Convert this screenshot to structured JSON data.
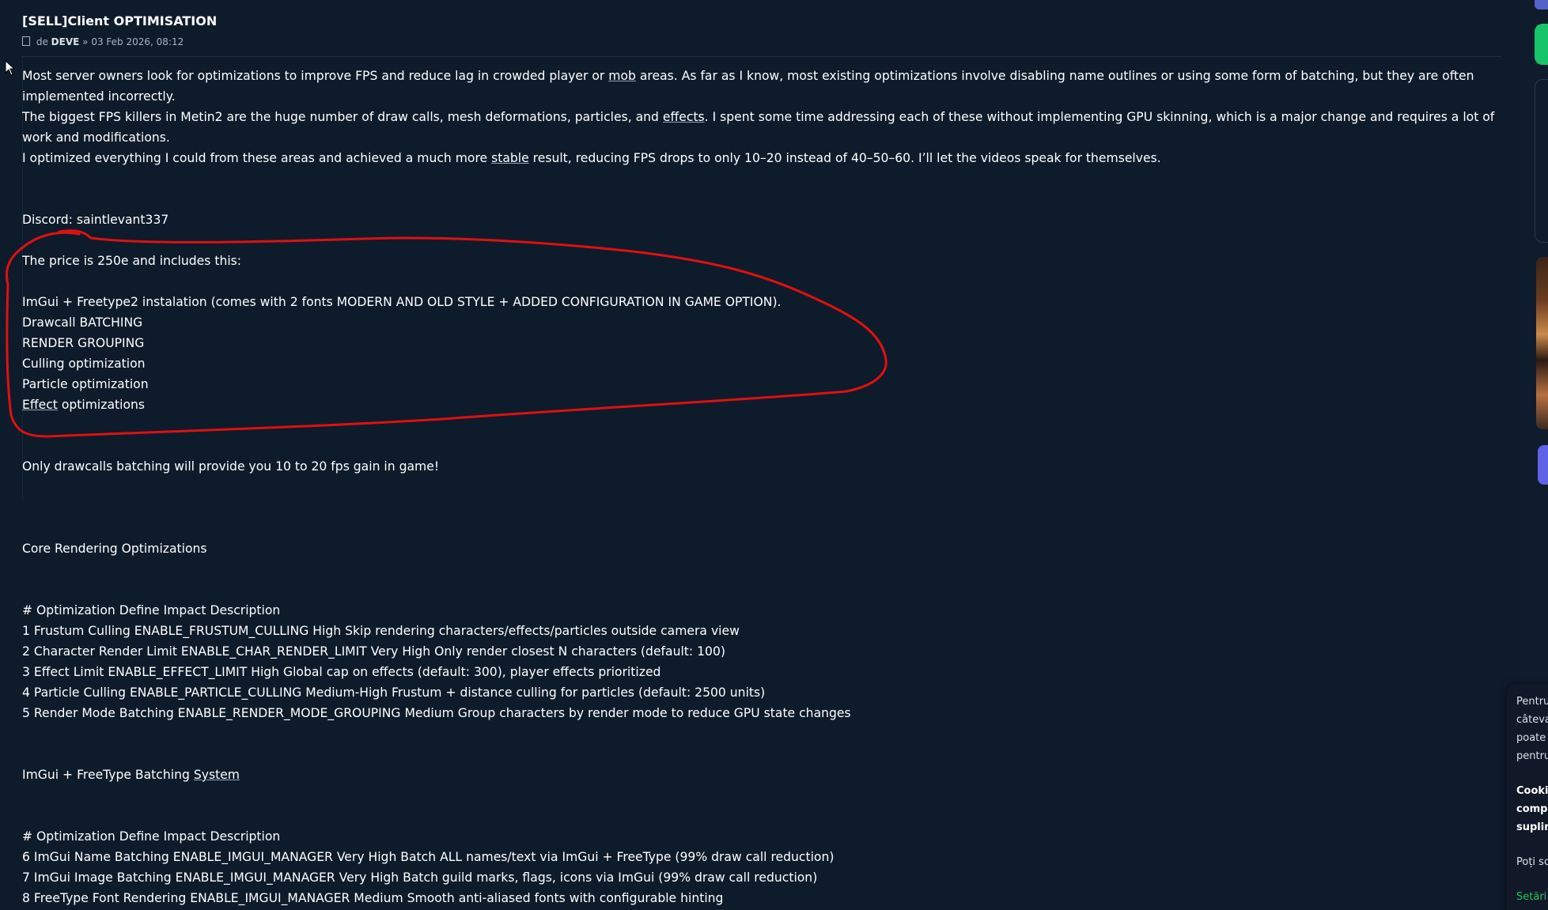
{
  "post": {
    "title": "[SELL]Client OPTIMISATION",
    "meta": {
      "prefix": "de",
      "author": "DEVE",
      "separator": "»",
      "date": "03 Feb 2026, 08:12"
    },
    "intro": {
      "p1a": "Most server owners look for optimizations to improve FPS and reduce lag in crowded player or ",
      "p1_link": "mob",
      "p1b": " areas. As far as I know, most existing optimizations involve disabling name outlines or using some form of batching, but they are often implemented incorrectly.",
      "p2a": "The biggest FPS killers in Metin2 are the huge number of draw calls, mesh deformations, particles, and ",
      "p2_link": "effects",
      "p2b": ". I spent some time addressing each of these without implementing GPU skinning, which is a major change and requires a lot of work and modifications.",
      "p3a": "I optimized everything I could from these areas and achieved a much more ",
      "p3_link": "stable",
      "p3b": " result, reducing FPS drops to only 10–20 instead of 40–50–60. I’ll let the videos speak for themselves."
    },
    "discord": "Discord: saintlevant337",
    "price": "The price is 250e and includes this:",
    "includes": [
      "ImGui + Freetype2 instalation (comes with 2 fonts MODERN AND OLD STYLE + ADDED CONFIGURATION IN GAME OPTION).",
      "Drawcall BATCHING",
      "RENDER GROUPING",
      "Culling optimization",
      "Particle optimization"
    ],
    "effect_link": "Effect",
    "effect_rest": " optimizations",
    "gain": "Only drawcalls batching will provide you 10 to 20 fps gain in game!",
    "core_heading": "Core Rendering Optimizations",
    "table1_header": "# Optimization Define Impact Description",
    "table1_rows": [
      "1 Frustum Culling ENABLE_FRUSTUM_CULLING High Skip rendering characters/effects/particles outside camera view",
      "2 Character Render Limit ENABLE_CHAR_RENDER_LIMIT Very High Only render closest N characters (default: 100)",
      "3 Effect Limit ENABLE_EFFECT_LIMIT High Global cap on effects (default: 300), player effects prioritized",
      "4 Particle Culling ENABLE_PARTICLE_CULLING Medium-High Frustum + distance culling for particles (default: 2500 units)",
      "5 Render Mode Batching ENABLE_RENDER_MODE_GROUPING Medium Group characters by render mode to reduce GPU state changes"
    ],
    "imgui_heading_a": "ImGui + FreeType Batching ",
    "imgui_heading_link": "System",
    "table2_header": "# Optimization Define Impact Description",
    "table2_rows": [
      "6 ImGui Name Batching ENABLE_IMGUI_MANAGER Very High Batch ALL names/text via ImGui + FreeType (99% draw call reduction)",
      "7 ImGui Image Batching ENABLE_IMGUI_MANAGER Very High Batch guild marks, flags, icons via ImGui (99% draw call reduction)",
      "8 FreeType Font Rendering ENABLE_IMGUI_MANAGER Medium Smooth anti-aliased fonts with configurable hinting"
    ]
  },
  "cookie": {
    "lines": [
      "Pentru",
      "câteva",
      "poate",
      "pentru"
    ],
    "bold_lines": [
      "Cooki",
      "compa",
      "suplim"
    ],
    "choice": "Poți sc",
    "settings_link": "Setări"
  },
  "colors": {
    "background": "#0e1b2b",
    "text": "#ffffff",
    "annotation": "#e01010",
    "accent_green": "#17c36b",
    "accent_violet": "#5f63e6"
  }
}
